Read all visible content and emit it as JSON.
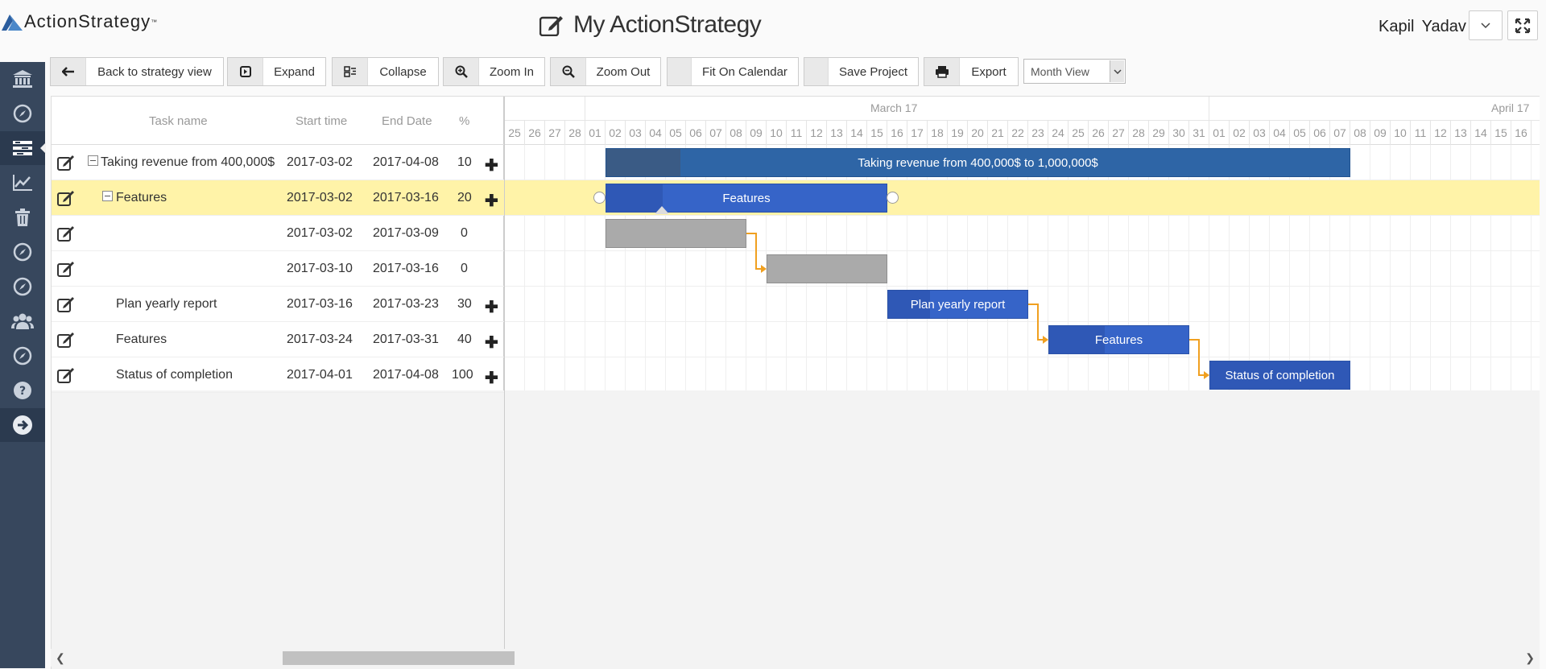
{
  "header": {
    "logo_text": "ActionStrategy",
    "logo_tm": "™",
    "app_title": "My ActionStrategy",
    "user_name": "Kapil Yadav"
  },
  "sidebar": {
    "items": [
      {
        "icon": "bank-icon"
      },
      {
        "icon": "compass-icon"
      },
      {
        "icon": "gantt-icon",
        "active": true
      },
      {
        "icon": "line-chart-icon"
      },
      {
        "icon": "trash-icon"
      },
      {
        "icon": "compass-icon"
      },
      {
        "icon": "compass-icon"
      },
      {
        "icon": "users-icon"
      },
      {
        "icon": "compass-icon"
      },
      {
        "icon": "help-icon"
      },
      {
        "icon": "arrow-right-circle-icon"
      }
    ]
  },
  "toolbar": {
    "back": "Back to strategy view",
    "expand": "Expand",
    "collapse": "Collapse",
    "zoom_in": "Zoom In",
    "zoom_out": "Zoom Out",
    "fit": "Fit On Calendar",
    "save": "Save Project",
    "export": "Export",
    "view": "Month View"
  },
  "grid": {
    "columns": {
      "task": "Task name",
      "start": "Start time",
      "end": "End Date",
      "pct": "%"
    },
    "rows": [
      {
        "name": "Taking revenue from 400,000$",
        "start": "2017-03-02",
        "end": "2017-04-08",
        "pct": "10",
        "plus": "✚"
      },
      {
        "name": "Features",
        "start": "2017-03-02",
        "end": "2017-03-16",
        "pct": "20",
        "plus": "✚"
      },
      {
        "name": "",
        "start": "2017-03-02",
        "end": "2017-03-09",
        "pct": "0",
        "plus": ""
      },
      {
        "name": "",
        "start": "2017-03-10",
        "end": "2017-03-16",
        "pct": "0",
        "plus": ""
      },
      {
        "name": "Plan yearly report",
        "start": "2017-03-16",
        "end": "2017-03-23",
        "pct": "30",
        "plus": "✚"
      },
      {
        "name": "Features",
        "start": "2017-03-24",
        "end": "2017-03-31",
        "pct": "40",
        "plus": "✚"
      },
      {
        "name": "Status of completion",
        "start": "2017-04-01",
        "end": "2017-04-08",
        "pct": "100",
        "plus": "✚"
      }
    ]
  },
  "timeline": {
    "month_labels": [
      "March 17",
      "April 17"
    ],
    "days": [
      "25",
      "26",
      "27",
      "28",
      "01",
      "02",
      "03",
      "04",
      "05",
      "06",
      "07",
      "08",
      "09",
      "10",
      "11",
      "12",
      "13",
      "14",
      "15",
      "16",
      "17",
      "18",
      "19",
      "20",
      "21",
      "22",
      "23",
      "24",
      "25",
      "26",
      "27",
      "28",
      "29",
      "30",
      "31",
      "01",
      "02",
      "03",
      "04",
      "05",
      "06",
      "07",
      "08",
      "09",
      "10",
      "11",
      "12",
      "13",
      "14",
      "15",
      "16"
    ]
  },
  "bars": [
    {
      "label": "Taking revenue from 400,000$ to 1,000,000$",
      "progress": 0.1
    },
    {
      "label": "Features",
      "progress": 0.2
    },
    {
      "label": "",
      "progress": 0
    },
    {
      "label": "",
      "progress": 0
    },
    {
      "label": "Plan yearly report",
      "progress": 0.3
    },
    {
      "label": "Features",
      "progress": 0.4
    },
    {
      "label": "Status of completion",
      "progress": 1.0
    }
  ]
}
